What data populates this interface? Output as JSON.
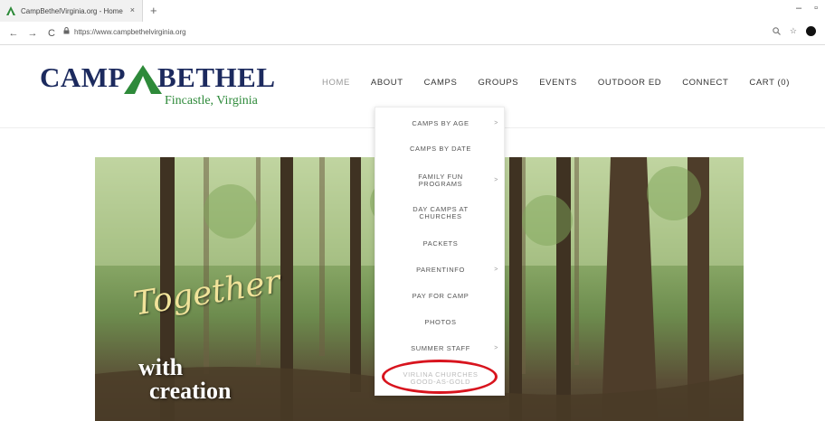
{
  "browser": {
    "tab_title": "CampBethelVirginia.org - Home",
    "tab_close": "×",
    "new_tab": "+",
    "url": "https://www.campbethelvirginia.org",
    "minimize": "–",
    "restore": "▫",
    "menu_dots": "⋮"
  },
  "logo": {
    "camp": "CAMP",
    "bethel": "BETHEL",
    "location": "Fincastle, Virginia",
    "colors": {
      "navy": "#1c2a5e",
      "green": "#2e8a3a"
    }
  },
  "nav": {
    "items": [
      "HOME",
      "ABOUT",
      "CAMPS",
      "GROUPS",
      "EVENTS",
      "OUTDOOR ED",
      "CONNECT",
      "CART (0)"
    ]
  },
  "dropdown": {
    "items": [
      {
        "label": "CAMPS BY AGE",
        "has_sub": true
      },
      {
        "label": "CAMPS BY DATE",
        "has_sub": false
      },
      {
        "label": "FAMILY FUN\nPROGRAMS",
        "has_sub": true
      },
      {
        "label": "DAY CAMPS AT\nCHURCHES",
        "has_sub": false
      },
      {
        "label": "PACKETS",
        "has_sub": false
      },
      {
        "label": "PARENTINFO",
        "has_sub": true
      },
      {
        "label": "PAY FOR CAMP",
        "has_sub": false
      },
      {
        "label": "PHOTOS",
        "has_sub": false
      },
      {
        "label": "SUMMER STAFF",
        "has_sub": true
      },
      {
        "label": "VIRLINA CHURCHES\nGOOD-AS-GOLD",
        "has_sub": false
      }
    ],
    "submenu_arrow": ">",
    "highlight_color": "#d8141e"
  },
  "hero": {
    "line1": "Together",
    "line2": "with",
    "line3": "creation"
  },
  "icons": {
    "back": "←",
    "forward": "→",
    "reload": "C",
    "lock": "🔒",
    "zoom": "🔍",
    "star": "☆"
  }
}
